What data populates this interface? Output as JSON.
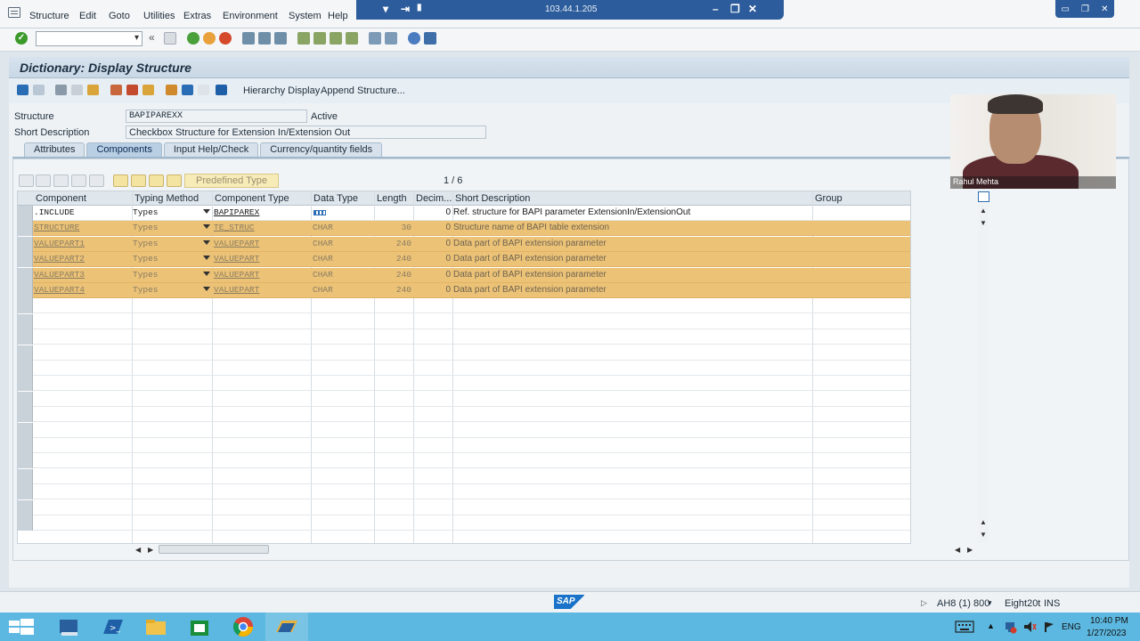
{
  "menu": [
    "Structure",
    "Edit",
    "Goto",
    "Utilities",
    "Extras",
    "Environment",
    "System",
    "Help"
  ],
  "remote": {
    "ip": "103.44.1.205"
  },
  "title": "Dictionary: Display Structure",
  "app_toolbar": {
    "hierarchy_display": "Hierarchy Display",
    "append_structure": "Append Structure..."
  },
  "header": {
    "structure_label": "Structure",
    "structure_value": "BAPIPAREXX",
    "status": "Active",
    "short_desc_label": "Short Description",
    "short_desc_value": "Checkbox Structure for Extension In/Extension Out"
  },
  "tabs": [
    "Attributes",
    "Components",
    "Input Help/Check",
    "Currency/quantity fields"
  ],
  "active_tab": "Components",
  "table_toolbar": {
    "predefined_type": "Predefined Type",
    "page": "1 / 6"
  },
  "columns": [
    "Component",
    "Typing Method",
    "Component Type",
    "Data Type",
    "Length",
    "Decim...",
    "Short Description",
    "Group"
  ],
  "rows": [
    {
      "component": ".INCLUDE",
      "typing": "Types",
      "comp_type": "BAPIPAREX",
      "data_type": "",
      "length": "",
      "decimals": "0",
      "desc": "Ref. structure for BAPI parameter ExtensionIn/ExtensionOut",
      "selected": false
    },
    {
      "component": "STRUCTURE",
      "typing": "Types",
      "comp_type": "TE_STRUC",
      "data_type": "CHAR",
      "length": "30",
      "decimals": "0",
      "desc": "Structure name of  BAPI table extension",
      "selected": true
    },
    {
      "component": "VALUEPART1",
      "typing": "Types",
      "comp_type": "VALUEPART",
      "data_type": "CHAR",
      "length": "240",
      "decimals": "0",
      "desc": "Data part of BAPI extension parameter",
      "selected": true
    },
    {
      "component": "VALUEPART2",
      "typing": "Types",
      "comp_type": "VALUEPART",
      "data_type": "CHAR",
      "length": "240",
      "decimals": "0",
      "desc": "Data part of BAPI extension parameter",
      "selected": true
    },
    {
      "component": "VALUEPART3",
      "typing": "Types",
      "comp_type": "VALUEPART",
      "data_type": "CHAR",
      "length": "240",
      "decimals": "0",
      "desc": "Data part of BAPI extension parameter",
      "selected": true
    },
    {
      "component": "VALUEPART4",
      "typing": "Types",
      "comp_type": "VALUEPART",
      "data_type": "CHAR",
      "length": "240",
      "decimals": "0",
      "desc": "Data part of BAPI extension parameter",
      "selected": true
    }
  ],
  "empty_rows": 15,
  "status_bar": {
    "system": "AH8 (1) 800",
    "server": "Eight20t",
    "mode": "INS"
  },
  "webcam": {
    "name": "Rahul Mehta"
  },
  "tray": {
    "language": "ENG",
    "time": "10:40 PM",
    "date": "1/27/2023"
  },
  "colors": {
    "selection": "#ecc277",
    "title_bg": "#c9d8e6",
    "taskbar": "#5cb8e0"
  }
}
